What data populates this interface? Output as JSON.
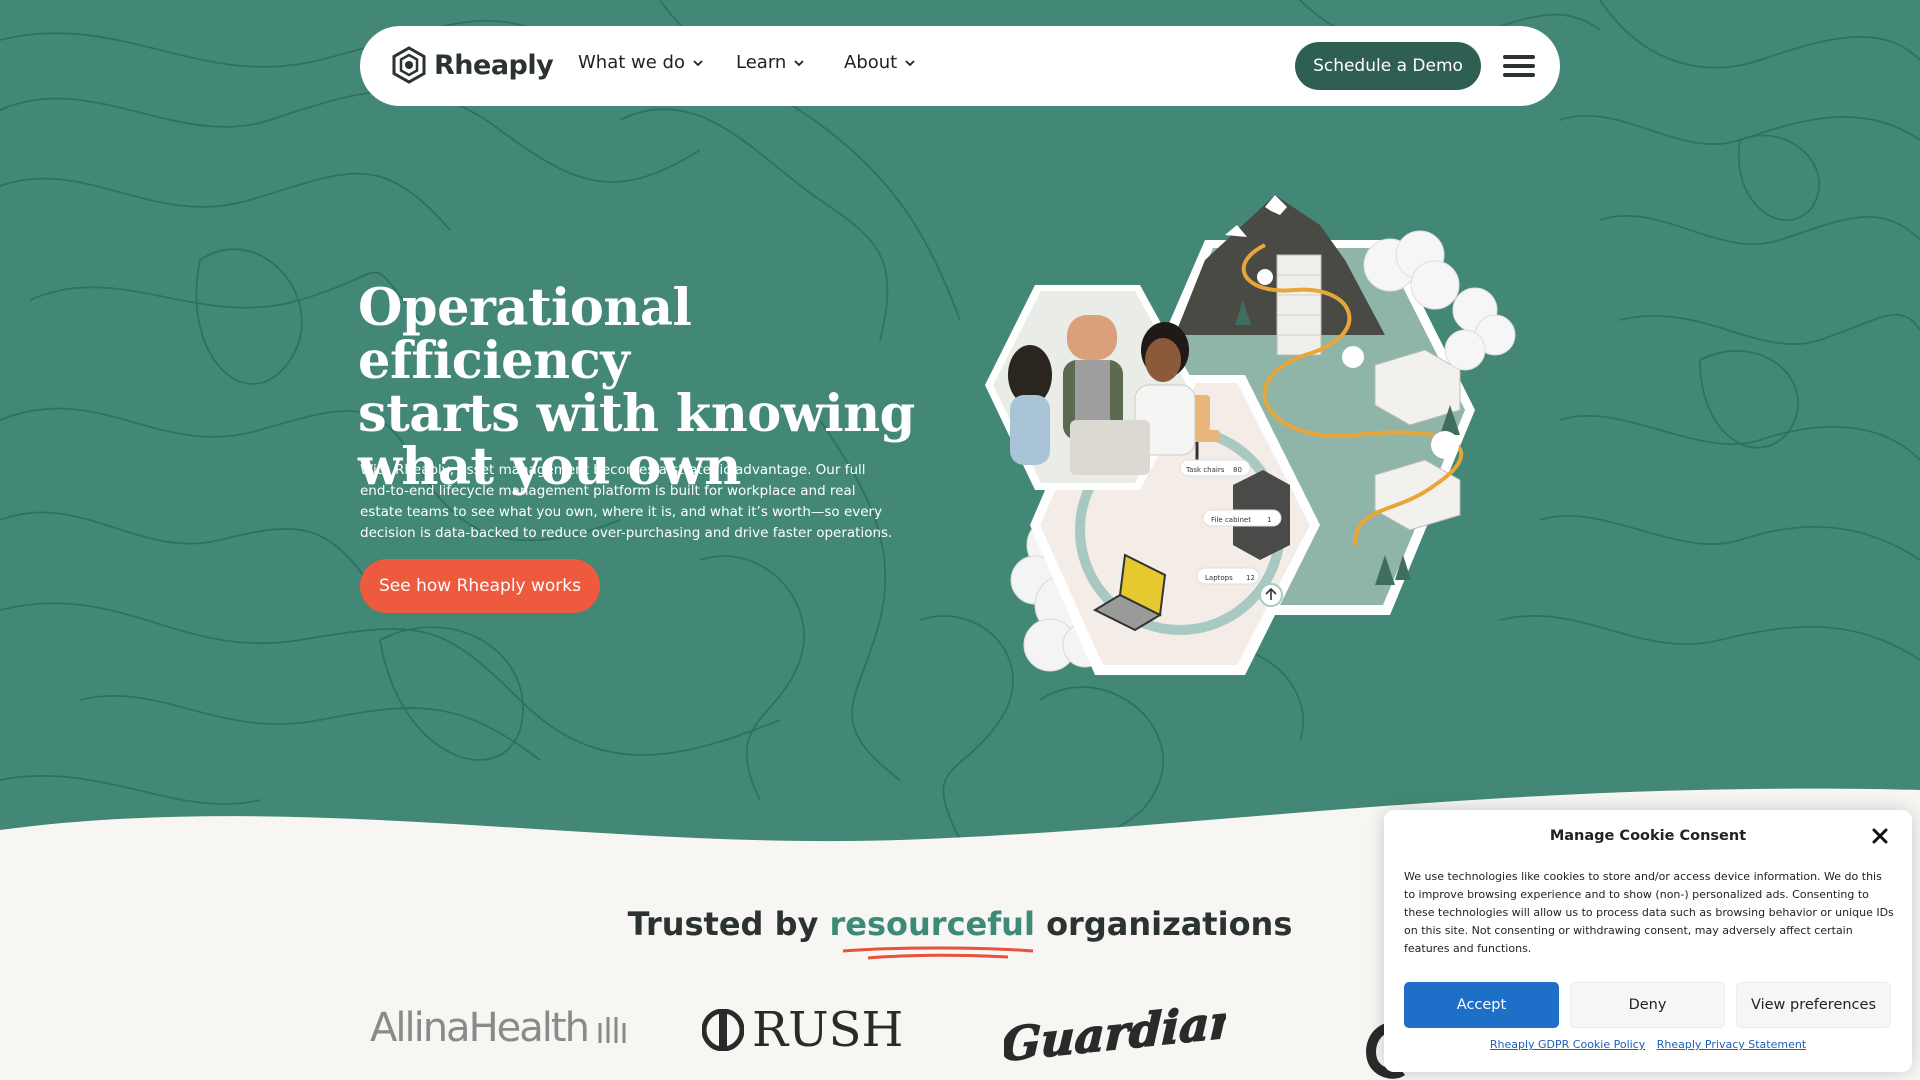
{
  "nav": {
    "logo_text": "Rheaply",
    "items": [
      {
        "label": "What we do"
      },
      {
        "label": "Learn"
      },
      {
        "label": "About"
      }
    ],
    "demo_label": "Schedule a Demo"
  },
  "hero": {
    "title_line1": "Operational efficiency",
    "title_line2": "starts with knowing",
    "title_line3": "what you own",
    "description": "With Rheaply, asset management becomes a strategic advantage. Our full end-to-end lifecycle management platform is built for workplace and real estate teams to see what you own, where it is, and what it’s worth—so every decision is data-backed to reduce over-purchasing and drive faster operations.",
    "cta_label": "See how Rheaply works",
    "illustration_labels": {
      "task_chairs": "Task chairs",
      "task_chairs_count": "80",
      "file_cabinet": "File cabinet",
      "file_cabinet_count": "1",
      "laptops": "Laptops",
      "laptops_count": "12"
    }
  },
  "trusted": {
    "prefix": "Trusted by",
    "accent": "resourceful",
    "suffix": "organizations",
    "logos": {
      "allina": "AllinaHealth",
      "rush": "RUSH",
      "guardians": "Guardians"
    }
  },
  "cookie": {
    "title": "Manage Cookie Consent",
    "text": "We use technologies like cookies to store and/or access device information. We do this to improve browsing experience and to show (non-) personalized ads. Consenting to these technologies will allow us to process data such as browsing behavior or unique IDs on this site. Not consenting or withdrawing consent, may adversely affect certain features and functions.",
    "accept_label": "Accept",
    "deny_label": "Deny",
    "prefs_label": "View preferences",
    "link_policy": "Rheaply GDPR Cookie Policy",
    "link_privacy": "Rheaply Privacy Statement"
  },
  "colors": {
    "background": "#438877",
    "contour": "#2c6d5e",
    "demo_button": "#2f5f53",
    "cta": "#ee5a3d",
    "accept": "#1e6fc7",
    "accent_text": "#3c8a77"
  },
  "icons": [
    "rheaply-logo-icon",
    "chevron-down-icon",
    "menu-icon",
    "close-icon",
    "upload-icon"
  ]
}
